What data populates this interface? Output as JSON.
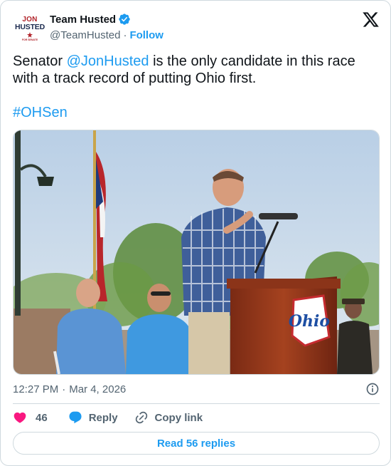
{
  "author": {
    "display_name": "Team Husted",
    "handle": "@TeamHusted",
    "follow_label": "Follow",
    "avatar_logo": {
      "line1": "JON",
      "line2": "HUSTED",
      "line3": "FOR SENATE"
    }
  },
  "tweet": {
    "text_before": "Senator ",
    "mention": "@JonHusted",
    "text_after": " is the only candidate in this race with a track record of putting Ohio first.",
    "hashtag": "#OHSen",
    "photo_sign_text": "Ohio"
  },
  "meta": {
    "time": "12:27 PM",
    "separator": "·",
    "date": "Mar 4, 2026"
  },
  "actions": {
    "like_count": "46",
    "reply_label": "Reply",
    "copy_link_label": "Copy link"
  },
  "read_replies_label": "Read 56 replies",
  "colors": {
    "link": "#1d9bf0",
    "like": "#f91880",
    "verified": "#1d9bf0",
    "text_secondary": "#536471",
    "border": "#cfd9de"
  },
  "icons": [
    "x-logo-icon",
    "verified-badge-icon",
    "info-icon",
    "heart-icon",
    "reply-bubble-icon",
    "link-icon"
  ]
}
